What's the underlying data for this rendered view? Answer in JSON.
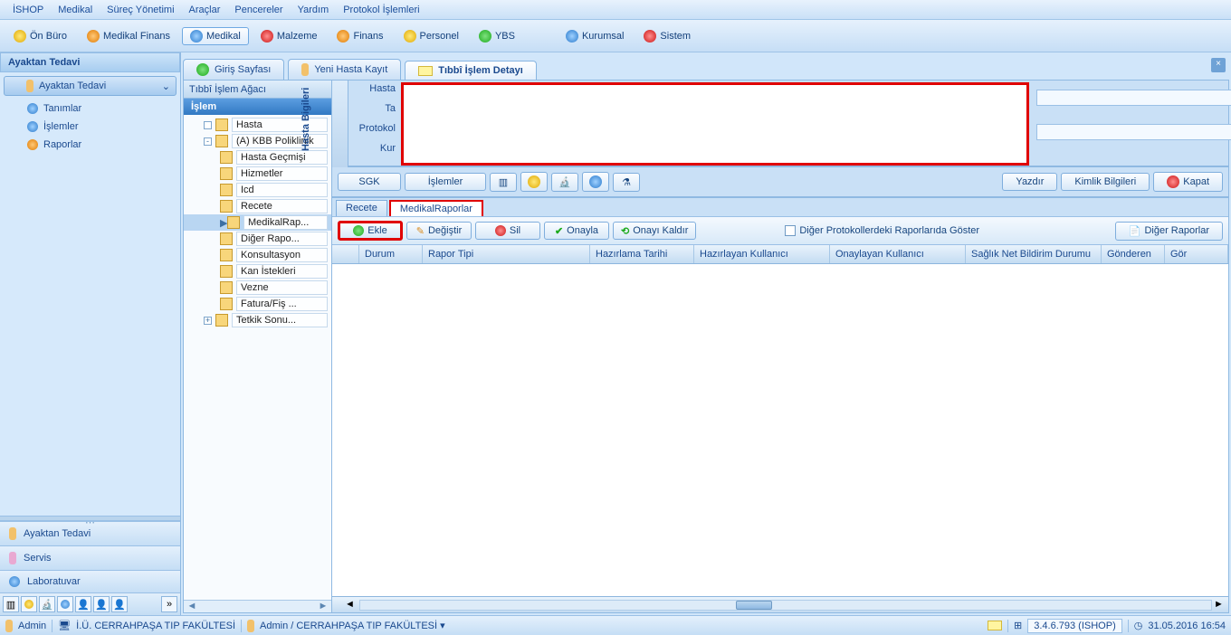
{
  "menu": {
    "items": [
      "İSHOP",
      "Medikal",
      "Süreç Yönetimi",
      "Araçlar",
      "Pencereler",
      "Yardım",
      "Protokol İşlemleri"
    ]
  },
  "modules": {
    "items": [
      {
        "label": "Ön Büro",
        "icon": "onburo"
      },
      {
        "label": "Medikal Finans",
        "icon": "medfinans"
      },
      {
        "label": "Medikal",
        "icon": "medikal",
        "active": true
      },
      {
        "label": "Malzeme",
        "icon": "malzeme"
      },
      {
        "label": "Finans",
        "icon": "finans"
      },
      {
        "label": "Personel",
        "icon": "personel"
      },
      {
        "label": "YBS",
        "icon": "ybs"
      },
      {
        "label": "Kurumsal",
        "icon": "kurumsal"
      },
      {
        "label": "Sistem",
        "icon": "sistem"
      }
    ]
  },
  "leftpanel": {
    "header": "Ayaktan Tedavi",
    "subheader": "Ayaktan Tedavi",
    "items": [
      "Tanımlar",
      "İşlemler",
      "Raporlar"
    ],
    "bottom": [
      "Ayaktan Tedavi",
      "Servis",
      "Laboratuvar"
    ]
  },
  "tabs": {
    "items": [
      {
        "label": "Giriş Sayfası",
        "icon": "home"
      },
      {
        "label": "Yeni Hasta Kayıt",
        "icon": "newpatient"
      },
      {
        "label": "Tıbbî İşlem Detayı",
        "icon": "detail",
        "active": true
      }
    ]
  },
  "tree": {
    "tab": "Tıbbî İşlem Ağacı",
    "header": "İşlem",
    "nodes": [
      {
        "label": "Hasta",
        "indent": 1,
        "toggle": "leaf"
      },
      {
        "label": "(A) KBB Poliklinik",
        "indent": 1,
        "toggle": "minus"
      },
      {
        "label": "Hasta Geçmişi",
        "indent": 2
      },
      {
        "label": "Hizmetler",
        "indent": 2
      },
      {
        "label": "Icd",
        "indent": 2
      },
      {
        "label": "Recete",
        "indent": 2
      },
      {
        "label": "MedikalRap...",
        "indent": 2,
        "selected": true
      },
      {
        "label": "Diğer Rapo...",
        "indent": 2
      },
      {
        "label": "Konsultasyon",
        "indent": 2
      },
      {
        "label": "Kan İstekleri",
        "indent": 2
      },
      {
        "label": "Vezne",
        "indent": 2
      },
      {
        "label": "Fatura/Fiş ...",
        "indent": 2
      },
      {
        "label": "Tetkik Sonu...",
        "indent": 2,
        "toggle": "plus",
        "plusLeft": true
      }
    ]
  },
  "info": {
    "vert_label": "Hasta Bigileri",
    "labels": [
      "Hasta",
      "Ta",
      "Protokol",
      "Kur"
    ]
  },
  "row2": {
    "sgk": "SGK",
    "islemler": "İşlemler",
    "yazdir": "Yazdır",
    "kimlik": "Kimlik Bilgileri",
    "kapat": "Kapat"
  },
  "innertabs": {
    "items": [
      {
        "label": "Recete"
      },
      {
        "label": "MedikalRaporlar",
        "active": true
      }
    ]
  },
  "row3": {
    "ekle": "Ekle",
    "degistir": "Değiştir",
    "sil": "Sil",
    "onayla": "Onayla",
    "onaykaldir": "Onayı Kaldır",
    "checkbox_label": "Diğer Protokollerdeki Raporlarıda Göster",
    "diger": "Diğer Raporlar"
  },
  "grid": {
    "columns": [
      {
        "label": "",
        "w": 30
      },
      {
        "label": "Durum",
        "w": 70
      },
      {
        "label": "Rapor Tipi",
        "w": 185
      },
      {
        "label": "Hazırlama Tarihi",
        "w": 115
      },
      {
        "label": "Hazırlayan Kullanıcı",
        "w": 150
      },
      {
        "label": "Onaylayan Kullanıcı",
        "w": 150
      },
      {
        "label": "Sağlık Net Bildirim Durumu",
        "w": 150
      },
      {
        "label": "Gönderen",
        "w": 70
      },
      {
        "label": "Gör",
        "w": 30
      }
    ]
  },
  "status": {
    "admin": "Admin",
    "org": "İ.Ü. CERRAHPAŞA TIP FAKÜLTESİ",
    "user_org": "Admin / CERRAHPAŞA TIP FAKÜLTESİ",
    "version": "3.4.6.793 (ISHOP)",
    "datetime": "31.05.2016 16:54"
  }
}
